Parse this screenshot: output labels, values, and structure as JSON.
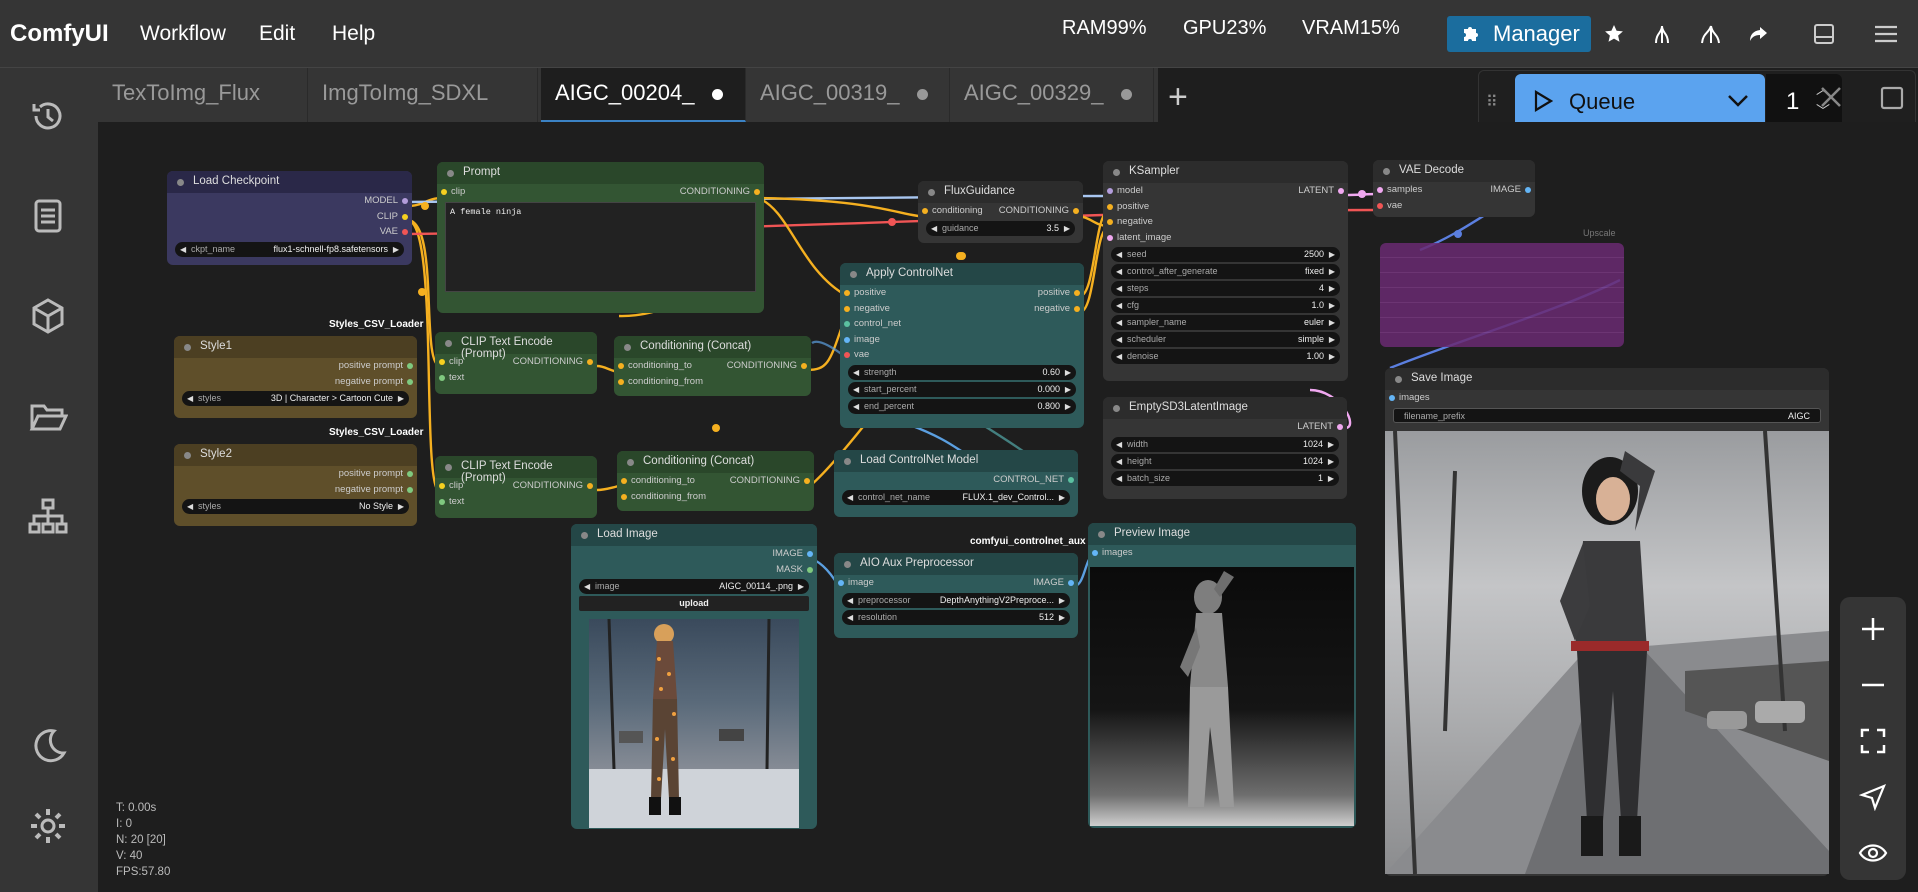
{
  "app": {
    "title": "ComfyUI",
    "menu": [
      "Workflow",
      "Edit",
      "Help"
    ]
  },
  "stats": {
    "ram": "RAM99%",
    "gpu": "GPU23%",
    "vram": "VRAM15%"
  },
  "manager": {
    "label": "Manager"
  },
  "tabs": [
    {
      "label": "TexToImg_Flux",
      "modified": false
    },
    {
      "label": "ImgToImg_SDXL",
      "modified": false
    },
    {
      "label": "AIGC_00204_",
      "modified": true,
      "active": true
    },
    {
      "label": "AIGC_00319_",
      "modified": true
    },
    {
      "label": "AIGC_00329_",
      "modified": true
    }
  ],
  "queue": {
    "label": "Queue",
    "count": "1"
  },
  "canvas_stats": {
    "t": "T: 0.00s",
    "i": "I: 0",
    "n": "N: 20 [20]",
    "v": "V: 40",
    "fps": "FPS:57.80"
  },
  "nodes": {
    "load_checkpoint": {
      "title": "Load Checkpoint",
      "outputs": [
        "MODEL",
        "CLIP",
        "VAE"
      ],
      "widget_label": "ckpt_name",
      "widget_value": "flux1-schnell-fp8.safetensors"
    },
    "prompt": {
      "title": "Prompt",
      "input": "clip",
      "output": "CONDITIONING",
      "text": "A female ninja"
    },
    "flux_guidance": {
      "title": "FluxGuidance",
      "input": "conditioning",
      "output": "CONDITIONING",
      "widget_label": "guidance",
      "widget_value": "3.5"
    },
    "ksampler": {
      "title": "KSampler",
      "inputs": [
        "model",
        "positive",
        "negative",
        "latent_image"
      ],
      "output": "LATENT",
      "widgets": [
        {
          "label": "seed",
          "value": "2500"
        },
        {
          "label": "control_after_generate",
          "value": "fixed"
        },
        {
          "label": "steps",
          "value": "4"
        },
        {
          "label": "cfg",
          "value": "1.0"
        },
        {
          "label": "sampler_name",
          "value": "euler"
        },
        {
          "label": "scheduler",
          "value": "simple"
        },
        {
          "label": "denoise",
          "value": "1.00"
        }
      ]
    },
    "vae_decode": {
      "title": "VAE Decode",
      "inputs": [
        "samples",
        "vae"
      ],
      "output": "IMAGE"
    },
    "upscale": {
      "title": "Upscale"
    },
    "style1": {
      "group": "Styles_CSV_Loader",
      "title": "Style1",
      "outputs": [
        "positive prompt",
        "negative prompt"
      ],
      "widget_label": "styles",
      "widget_value": "3D | Character > Cartoon Cute"
    },
    "style2": {
      "group": "Styles_CSV_Loader",
      "title": "Style2",
      "outputs": [
        "positive prompt",
        "negative prompt"
      ],
      "widget_label": "styles",
      "widget_value": "No Style"
    },
    "clip_encode_1": {
      "title": "CLIP Text Encode (Prompt)",
      "inputs": [
        "clip",
        "text"
      ],
      "output": "CONDITIONING"
    },
    "clip_encode_2": {
      "title": "CLIP Text Encode (Prompt)",
      "inputs": [
        "clip",
        "text"
      ],
      "output": "CONDITIONING"
    },
    "concat_1": {
      "title": "Conditioning (Concat)",
      "inputs": [
        "conditioning_to",
        "conditioning_from"
      ],
      "output": "CONDITIONING"
    },
    "concat_2": {
      "title": "Conditioning (Concat)",
      "inputs": [
        "conditioning_to",
        "conditioning_from"
      ],
      "output": "CONDITIONING"
    },
    "apply_controlnet": {
      "title": "Apply ControlNet",
      "inputs": [
        "positive",
        "negative",
        "control_net",
        "image",
        "vae"
      ],
      "outputs": [
        "positive",
        "negative"
      ],
      "widgets": [
        {
          "label": "strength",
          "value": "0.60"
        },
        {
          "label": "start_percent",
          "value": "0.000"
        },
        {
          "label": "end_percent",
          "value": "0.800"
        }
      ]
    },
    "empty_latent": {
      "title": "EmptySD3LatentImage",
      "output": "LATENT",
      "widgets": [
        {
          "label": "width",
          "value": "1024"
        },
        {
          "label": "height",
          "value": "1024"
        },
        {
          "label": "batch_size",
          "value": "1"
        }
      ]
    },
    "load_controlnet": {
      "title": "Load ControlNet Model",
      "output": "CONTROL_NET",
      "widget_label": "control_net_name",
      "widget_value": "FLUX.1_dev_Control..."
    },
    "save_image": {
      "title": "Save Image",
      "input": "images",
      "widget_label": "filename_prefix",
      "widget_value": "AIGC"
    },
    "load_image": {
      "title": "Load Image",
      "outputs": [
        "IMAGE",
        "MASK"
      ],
      "widget_label": "image",
      "widget_value": "AIGC_00114_.png",
      "upload": "upload"
    },
    "aio_aux": {
      "group": "comfyui_controlnet_aux",
      "title": "AIO Aux Preprocessor",
      "input": "image",
      "output": "IMAGE",
      "widgets": [
        {
          "label": "preprocessor",
          "value": "DepthAnythingV2Preproce..."
        },
        {
          "label": "resolution",
          "value": "512"
        }
      ]
    },
    "preview_image": {
      "title": "Preview Image",
      "input": "images"
    }
  },
  "colors": {
    "accent": "#3b82c4",
    "queue": "#5ba3ef",
    "manager": "#1b6d9e"
  }
}
